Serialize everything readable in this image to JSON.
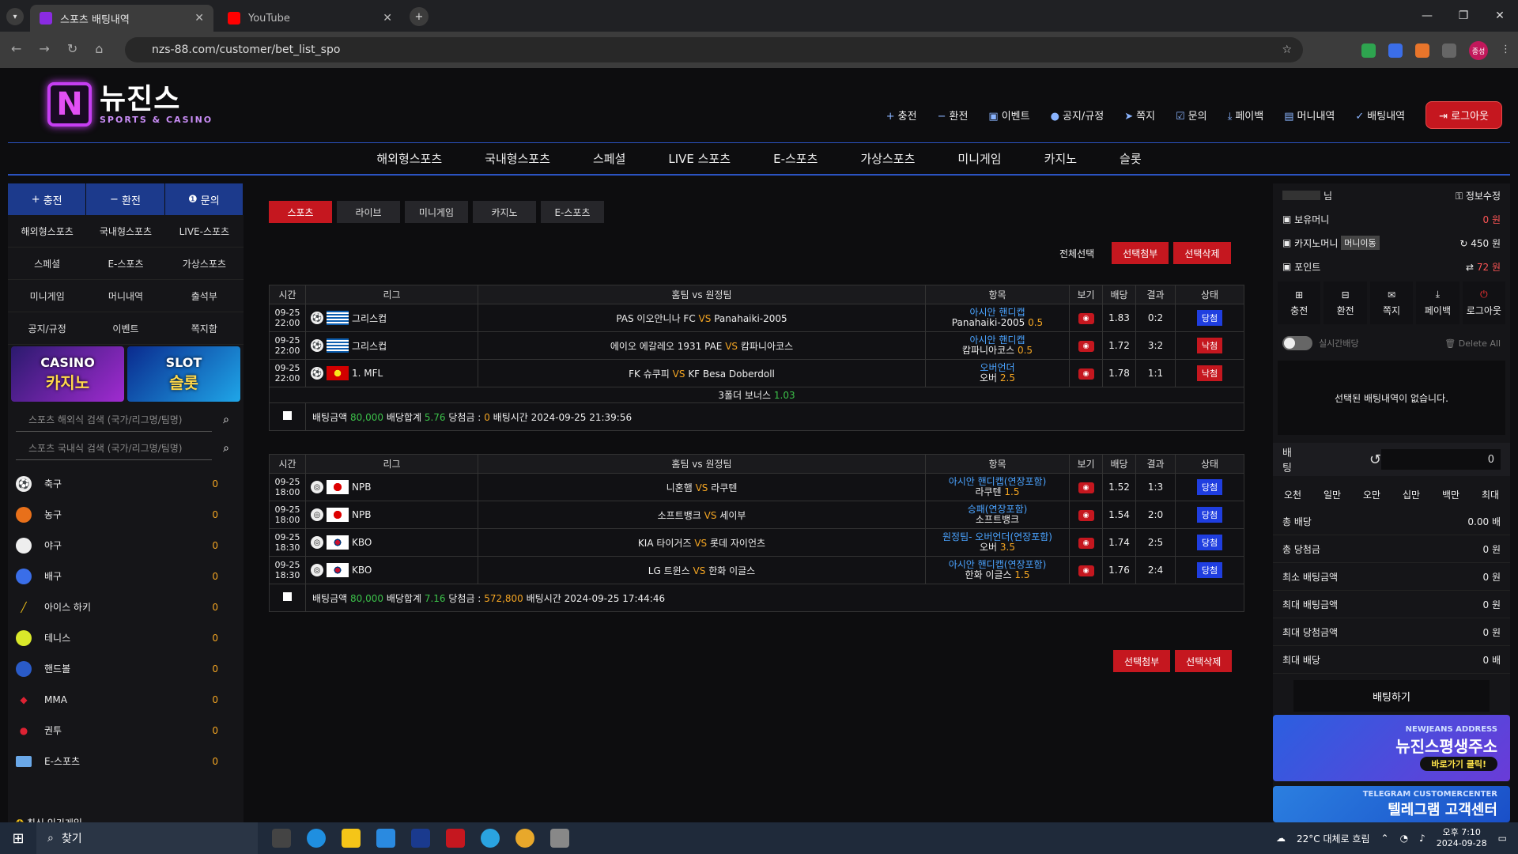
{
  "browser": {
    "tabs": [
      {
        "title": "스포츠 배팅내역",
        "active": true
      },
      {
        "title": "YouTube",
        "active": false
      }
    ],
    "url": "nzs-88.com/customer/bet_list_spo",
    "profile": "종성"
  },
  "site": {
    "logo_kr": "뉴진스",
    "logo_en": "SPORTS & CASINO",
    "logo_mark": "N",
    "topmenu": [
      "충전",
      "환전",
      "이벤트",
      "공지/규정",
      "쪽지",
      "문의",
      "페이백",
      "머니내역",
      "배팅내역"
    ],
    "logout": "로그아웃",
    "mainnav": [
      "해외형스포츠",
      "국내형스포츠",
      "스페셜",
      "LIVE 스포츠",
      "E-스포츠",
      "가상스포츠",
      "미니게임",
      "카지노",
      "슬롯"
    ]
  },
  "left": {
    "top_buttons": [
      "충전",
      "환전",
      "문의"
    ],
    "grid": [
      "해외형스포츠",
      "국내형스포츠",
      "LIVE-스포츠",
      "스페셜",
      "E-스포츠",
      "가상스포츠",
      "미니게임",
      "머니내역",
      "출석부",
      "공지/규정",
      "이벤트",
      "쪽지함"
    ],
    "banner_casino_en": "CASINO",
    "banner_casino_kr": "카지노",
    "banner_slot_en": "SLOT",
    "banner_slot_kr": "슬롯",
    "search1": "스포츠 해외식 검색 (국가/리그명/팀명)",
    "search2": "스포츠 국내식 검색 (국가/리그명/팀명)",
    "sports": [
      {
        "name": "축구",
        "count": "0"
      },
      {
        "name": "농구",
        "count": "0"
      },
      {
        "name": "야구",
        "count": "0"
      },
      {
        "name": "배구",
        "count": "0"
      },
      {
        "name": "아이스 하키",
        "count": "0"
      },
      {
        "name": "테니스",
        "count": "0"
      },
      {
        "name": "핸드볼",
        "count": "0"
      },
      {
        "name": "MMA",
        "count": "0"
      },
      {
        "name": "권투",
        "count": "0"
      },
      {
        "name": "E-스포츠",
        "count": "0"
      }
    ],
    "popular": "최신 인기게임"
  },
  "center": {
    "tabs": [
      "스포츠",
      "라이브",
      "미니게임",
      "카지노",
      "E-스포츠"
    ],
    "select_all": "전체선택",
    "btn_attach": "선택첨부",
    "btn_delete": "선택삭제",
    "headers": [
      "시간",
      "리그",
      "홈팀 vs 원정팀",
      "항목",
      "보기",
      "배당",
      "결과",
      "상태"
    ],
    "vs": "VS",
    "slip1": {
      "rows": [
        {
          "date": "09-25",
          "time": "22:00",
          "league": "그리스컵",
          "home": "PAS 이오안니나 FC",
          "away": "Panahaiki-2005",
          "item1": "아시안 핸디캡",
          "item2": "Panahaiki-2005",
          "item_odd": "0.5",
          "odds": "1.83",
          "result": "0:2",
          "status": "당첨"
        },
        {
          "date": "09-25",
          "time": "22:00",
          "league": "그리스컵",
          "home": "에이오 에갈레오 1931 PAE",
          "away": "캄파니아코스",
          "item1": "아시안 핸디캡",
          "item2": "캄파니아코스",
          "item_odd": "0.5",
          "odds": "1.72",
          "result": "3:2",
          "status": "낙첨"
        },
        {
          "date": "09-25",
          "time": "22:00",
          "league": "1. MFL",
          "home": "FK 슈쿠피",
          "away": "KF Besa Doberdoll",
          "item1": "오버언더",
          "item2": "오버",
          "item_odd": "2.5",
          "odds": "1.78",
          "result": "1:1",
          "status": "낙첨"
        }
      ],
      "bonus_label": "3폴더 보너스",
      "bonus_value": "1.03",
      "sum_bet_label": "배팅금액",
      "sum_bet": "80,000",
      "sum_odds_label": "배당합계",
      "sum_odds": "5.76",
      "win_label": "당첨금 :",
      "win": "0",
      "time_label": "배팅시간",
      "time": "2024-09-25 21:39:56"
    },
    "slip2": {
      "rows": [
        {
          "date": "09-25",
          "time": "18:00",
          "league": "NPB",
          "home": "니혼햄",
          "away": "라쿠텐",
          "item1": "아시안 핸디캡(연장포함)",
          "item2": "라쿠텐",
          "item_odd": "1.5",
          "odds": "1.52",
          "result": "1:3",
          "status": "당첨"
        },
        {
          "date": "09-25",
          "time": "18:00",
          "league": "NPB",
          "home": "소프트뱅크",
          "away": "세이부",
          "item1": "승패(연장포함)",
          "item2": "소프트뱅크",
          "item_odd": "",
          "odds": "1.54",
          "result": "2:0",
          "status": "당첨"
        },
        {
          "date": "09-25",
          "time": "18:30",
          "league": "KBO",
          "home": "KIA 타이거즈",
          "away": "롯데 자이언츠",
          "item1": "원정팀- 오버언더(연장포함)",
          "item2": "오버",
          "item_odd": "3.5",
          "odds": "1.74",
          "result": "2:5",
          "status": "당첨"
        },
        {
          "date": "09-25",
          "time": "18:30",
          "league": "KBO",
          "home": "LG 트윈스",
          "away": "한화 이글스",
          "item1": "아시안 핸디캡(연장포함)",
          "item2": "한화 이글스",
          "item_odd": "1.5",
          "odds": "1.76",
          "result": "2:4",
          "status": "당첨"
        }
      ],
      "sum_bet_label": "배팅금액",
      "sum_bet": "80,000",
      "sum_odds_label": "배당합계",
      "sum_odds": "7.16",
      "win_label": "당첨금 :",
      "win": "572,800",
      "time_label": "배팅시간",
      "time": "2024-09-25 17:44:46"
    }
  },
  "right": {
    "user_suffix": "님",
    "edit_info": "정보수정",
    "money_label": "보유머니",
    "money": "0 원",
    "casino_label": "카지노머니",
    "casino_move": "머니이동",
    "casino_money": "450 원",
    "point_label": "포인트",
    "point": "72 원",
    "quick": [
      "충전",
      "환전",
      "쪽지",
      "페이백",
      "로그아웃"
    ],
    "realtime": "실시간배당",
    "delete_all": "Delete All",
    "no_bets": "선택된 배팅내역이 없습니다.",
    "bet_label": "배팅",
    "bet_amount": "0",
    "amount_buttons": [
      "오천",
      "일만",
      "오만",
      "십만",
      "백만",
      "최대"
    ],
    "summary": [
      {
        "label": "총 배당",
        "value": "0.00 배"
      },
      {
        "label": "총 당첨금",
        "value": "0 원"
      },
      {
        "label": "최소 배팅금액",
        "value": "0 원"
      },
      {
        "label": "최대 배팅금액",
        "value": "0 원"
      },
      {
        "label": "최대 당첨금액",
        "value": "0 원"
      },
      {
        "label": "최대 배당",
        "value": "0 배"
      }
    ],
    "do_bet": "배팅하기",
    "promo1_top": "NEWJEANS ADDRESS",
    "promo1_main": "뉴진스평생주소",
    "promo1_btn": "바로가기 클릭!",
    "promo2_top": "TELEGRAM CUSTOMERCENTER",
    "promo2_main": "텔레그램 고객센터"
  },
  "taskbar": {
    "search": "찾기",
    "weather": "22°C 대체로 흐림",
    "time": "오후 7:10",
    "date": "2024-09-28"
  }
}
